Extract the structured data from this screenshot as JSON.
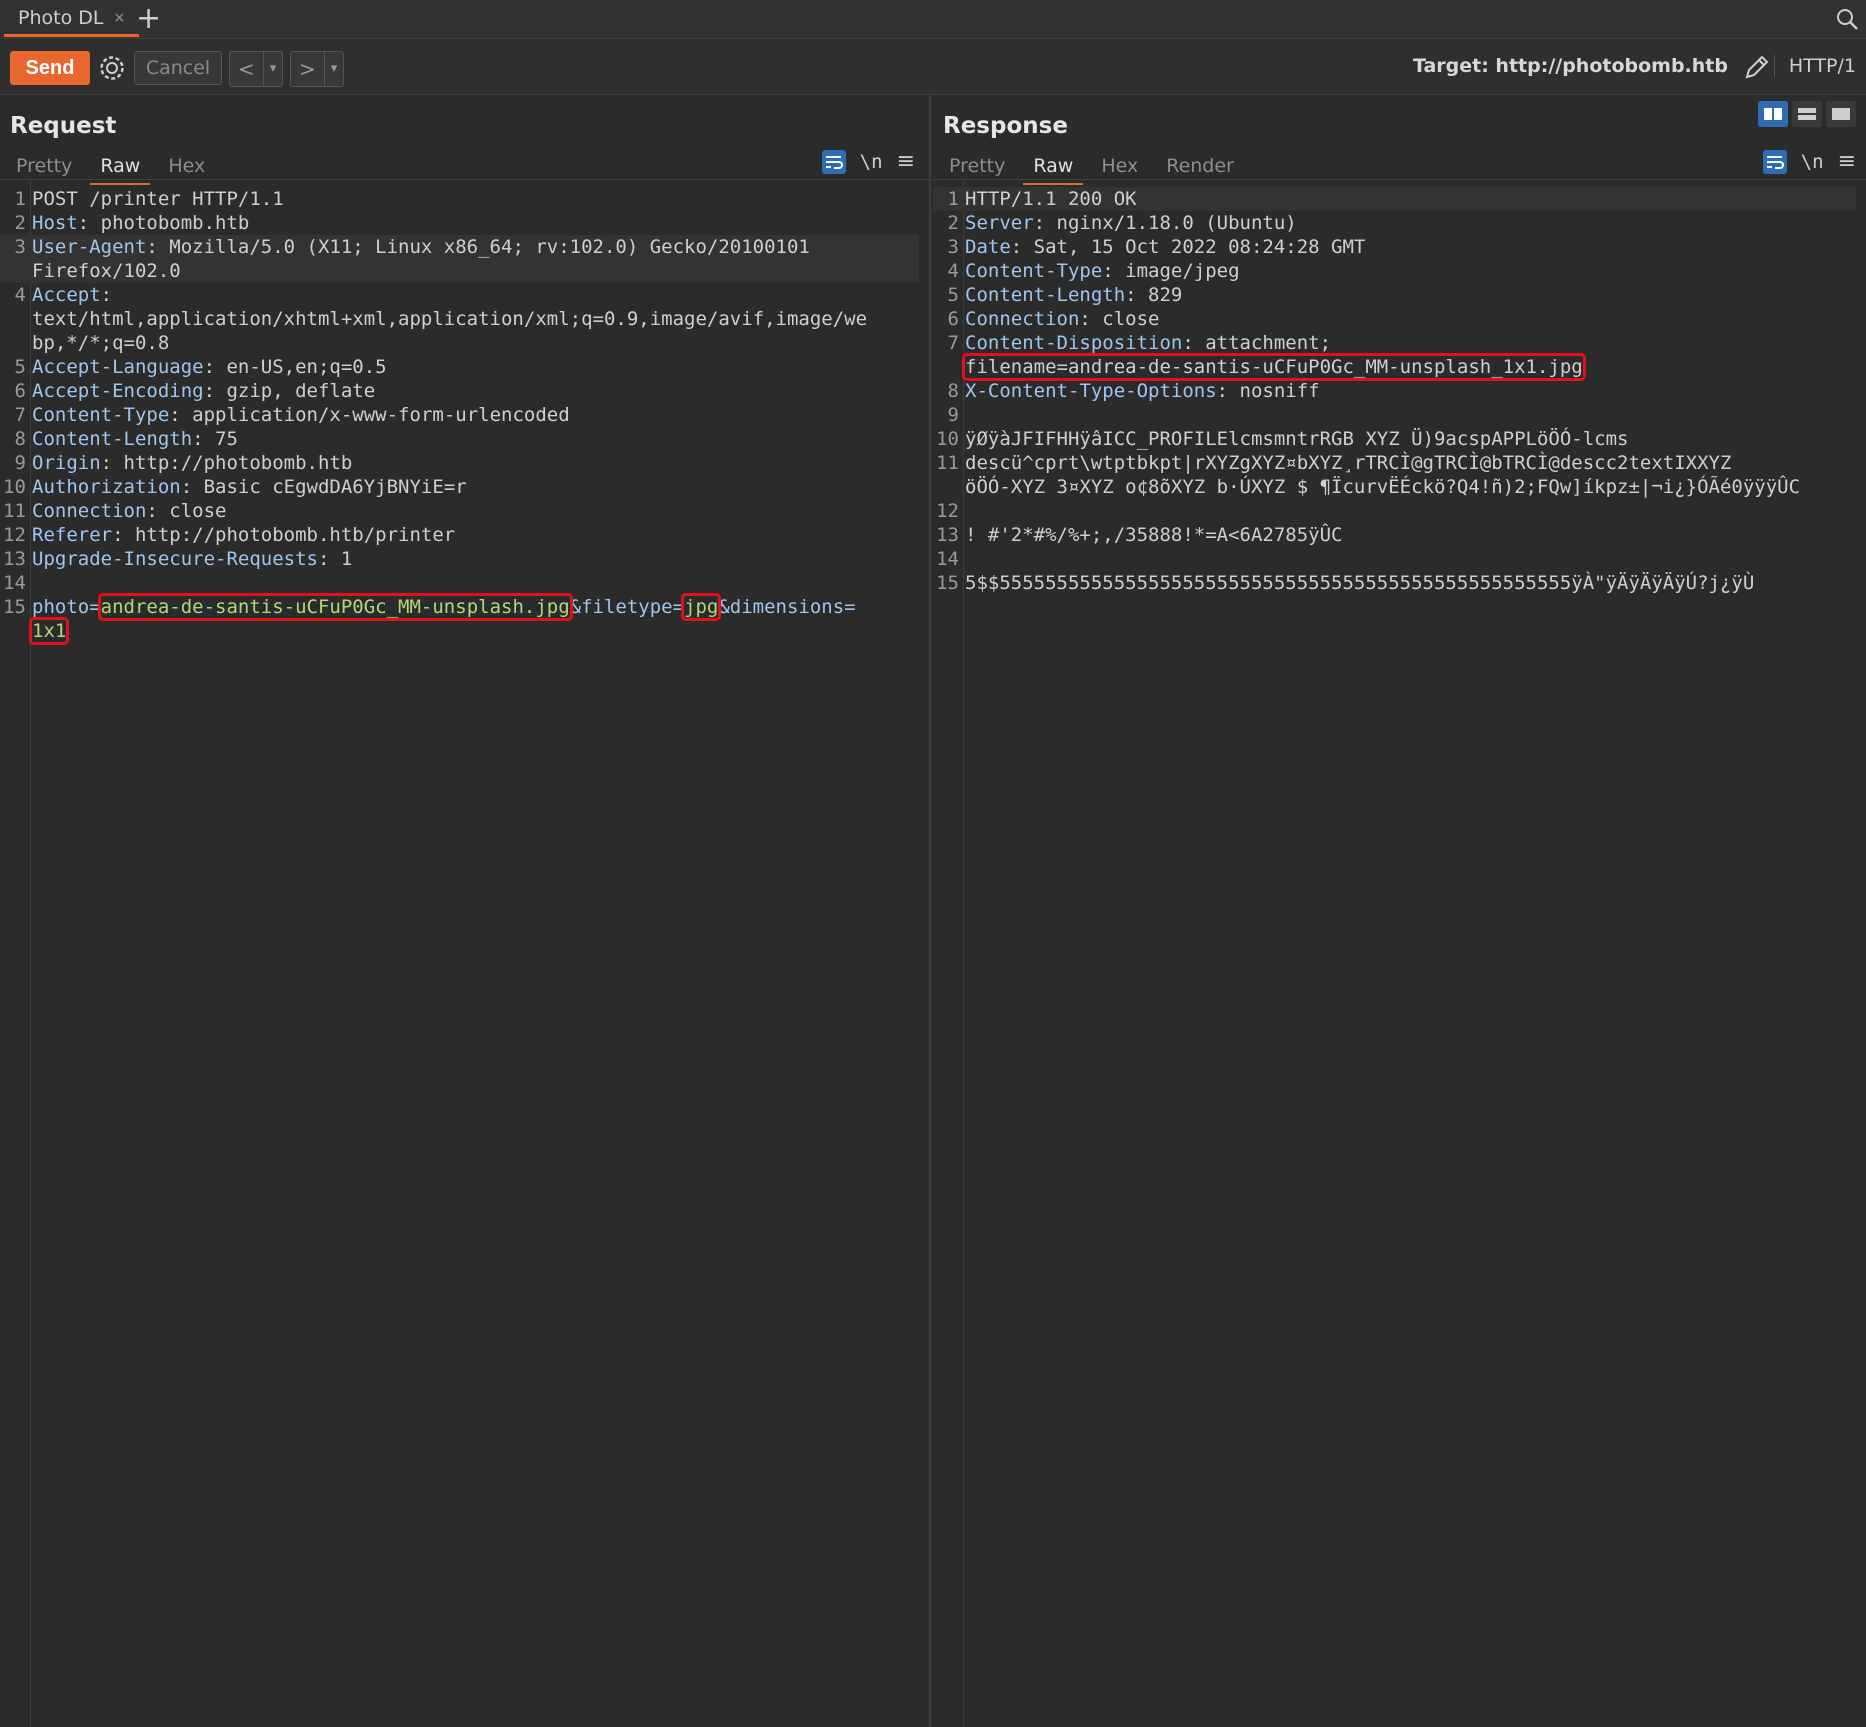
{
  "tab": {
    "title": "Photo DL",
    "close": "×",
    "add": "+"
  },
  "toolbar": {
    "send": "Send",
    "cancel": "Cancel",
    "back": "<",
    "forward": ">",
    "dropdown": "▾",
    "target_label": "Target: http://photobomb.htb",
    "http_version": "HTTP/1"
  },
  "request": {
    "title": "Request",
    "tabs": [
      "Pretty",
      "Raw",
      "Hex"
    ],
    "active_tab": "Raw",
    "newline_toggle": "\\n",
    "lines": [
      {
        "n": "1",
        "h": "",
        "v": "POST /printer HTTP/1.1"
      },
      {
        "n": "2",
        "h": "Host",
        "v": ": photobomb.htb"
      },
      {
        "n": "3",
        "h": "User-Agent",
        "v": ": Mozilla/5.0 (X11; Linux x86_64; rv:102.0) Gecko/20100101"
      },
      {
        "n": "",
        "h": "",
        "v": "Firefox/102.0"
      },
      {
        "n": "4",
        "h": "Accept",
        "v": ":"
      },
      {
        "n": "",
        "h": "",
        "v": "text/html,application/xhtml+xml,application/xml;q=0.9,image/avif,image/we"
      },
      {
        "n": "",
        "h": "",
        "v": "bp,*/*;q=0.8"
      },
      {
        "n": "5",
        "h": "Accept-Language",
        "v": ": en-US,en;q=0.5"
      },
      {
        "n": "6",
        "h": "Accept-Encoding",
        "v": ": gzip, deflate"
      },
      {
        "n": "7",
        "h": "Content-Type",
        "v": ": application/x-www-form-urlencoded"
      },
      {
        "n": "8",
        "h": "Content-Length",
        "v": ": 75"
      },
      {
        "n": "9",
        "h": "Origin",
        "v": ": http://photobomb.htb"
      },
      {
        "n": "10",
        "h": "Authorization",
        "v": ": Basic cEgwdDA6YjBNYiE=r"
      },
      {
        "n": "11",
        "h": "Connection",
        "v": ": close"
      },
      {
        "n": "12",
        "h": "Referer",
        "v": ": http://photobomb.htb/printer"
      },
      {
        "n": "13",
        "h": "Upgrade-Insecure-Requests",
        "v": ": 1"
      },
      {
        "n": "14",
        "h": "",
        "v": ""
      }
    ],
    "body_line_num": "15",
    "body": {
      "p1": "photo=",
      "photo": "andrea-de-santis-uCFuP0Gc_MM-unsplash.jpg",
      "p2": "&filetype=",
      "filetype": "jpg",
      "p3": "&dimensions=",
      "dimensions": "1x1"
    }
  },
  "response": {
    "title": "Response",
    "tabs": [
      "Pretty",
      "Raw",
      "Hex",
      "Render"
    ],
    "active_tab": "Raw",
    "newline_toggle": "\\n",
    "lines": [
      {
        "n": "1",
        "h": "",
        "v": "HTTP/1.1 200 OK"
      },
      {
        "n": "2",
        "h": "Server",
        "v": ": nginx/1.18.0 (Ubuntu)"
      },
      {
        "n": "3",
        "h": "Date",
        "v": ": Sat, 15 Oct 2022 08:24:28 GMT"
      },
      {
        "n": "4",
        "h": "Content-Type",
        "v": ": image/jpeg"
      },
      {
        "n": "5",
        "h": "Content-Length",
        "v": ": 829"
      },
      {
        "n": "6",
        "h": "Connection",
        "v": ": close"
      },
      {
        "n": "7",
        "h": "Content-Disposition",
        "v": ": attachment;"
      }
    ],
    "filename_line": "filename=andrea-de-santis-uCFuP0Gc_MM-unsplash_1x1.jpg",
    "lines2": [
      {
        "n": "8",
        "h": "X-Content-Type-Options",
        "v": ": nosniff"
      },
      {
        "n": "9",
        "h": "",
        "v": ""
      },
      {
        "n": "10",
        "h": "",
        "v": "ÿØÿàJFIFHHÿâICC_PROFILElcmsmntrRGB XYZ Ü)9acspAPPLöÖÓ-lcms"
      },
      {
        "n": "11",
        "h": "",
        "v": "descü^cprt\\wtptbkpt|rXYZgXYZ¤bXYZ¸rTRCÌ@gTRCÌ@bTRCÌ@descc2textIXXYZ"
      },
      {
        "n": "",
        "h": "",
        "v": "öÖÓ-XYZ 3¤XYZ o¢8õXYZ b·ÚXYZ $ ¶ÏcurvËÉckö?Q4!ñ)2;FQw]íkpz±|¬i¿}ÓÃé0ÿÿÿÛC"
      },
      {
        "n": "",
        "h": "",
        "v": ""
      },
      {
        "n": "",
        "h": "",
        "v": ""
      },
      {
        "n": "12",
        "h": "",
        "v": ""
      },
      {
        "n": "13",
        "h": "",
        "v": "! #'2*#%/%+;,/35888!*=A<6A2785ÿÛC"
      },
      {
        "n": "14",
        "h": "",
        "v": ""
      },
      {
        "n": "15",
        "h": "",
        "v": "5$$55555555555555555555555555555555555555555555555555ÿÀ\"ÿÄÿÄÿÄÿÚ?j¿ÿÙ"
      }
    ]
  }
}
